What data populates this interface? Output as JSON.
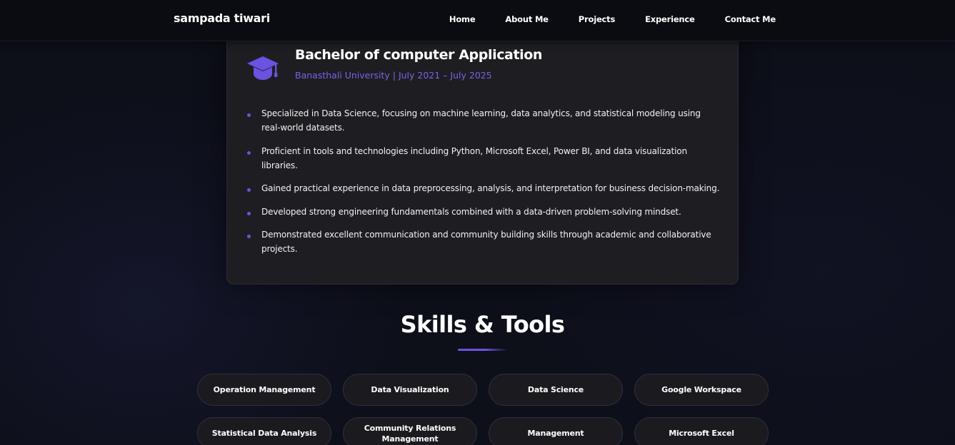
{
  "nav": {
    "brand": "sampada tiwari",
    "links": [
      "Home",
      "About Me",
      "Projects",
      "Experience",
      "Contact Me"
    ]
  },
  "education": {
    "icon": "graduation-cap-icon",
    "degree": "Bachelor of computer Application",
    "school": "Banasthali University | July 2021 – July 2025",
    "points": [
      "Specialized in Data Science, focusing on machine learning, data analytics, and statistical modeling using real-world datasets.",
      "Proficient in tools and technologies including Python, Microsoft Excel, Power BI, and data visualization libraries.",
      "Gained practical experience in data preprocessing, analysis, and interpretation for business decision-making.",
      "Developed strong engineering fundamentals combined with a data-driven problem-solving mindset.",
      "Demonstrated excellent communication and community building skills through academic and collaborative projects."
    ]
  },
  "skills": {
    "title": "Skills & Tools",
    "items": [
      "Operation Management",
      "Data Visualization",
      "Data Science",
      "Google Workspace",
      "Statistical Data Analysis",
      "Community Relations Management",
      "Management",
      "Microsoft Excel"
    ]
  },
  "colors": {
    "accent": "#6c52e0",
    "school_text": "#7b62e6",
    "background": "#0d0f19",
    "card": "#1e1e22"
  }
}
